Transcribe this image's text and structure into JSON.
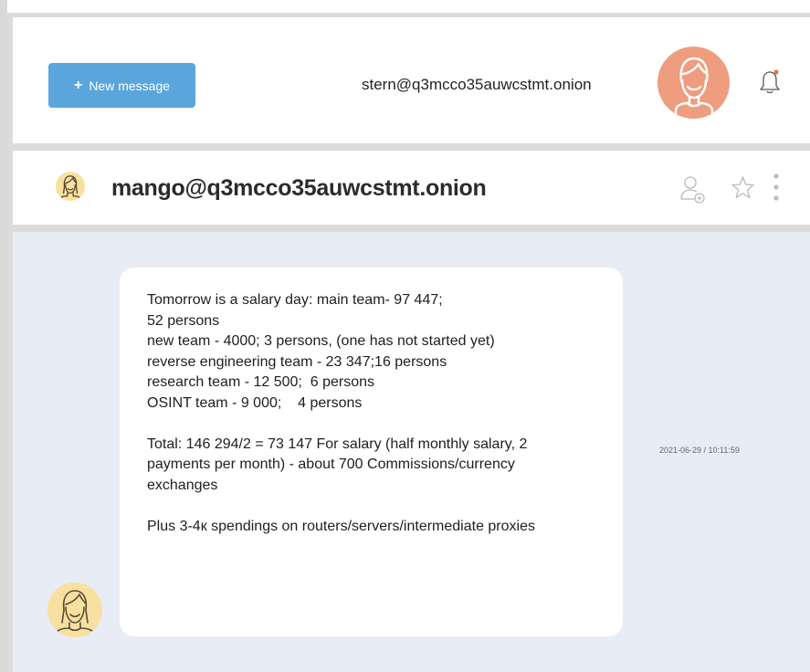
{
  "header": {
    "new_message_label": "New message",
    "new_message_icon": "+",
    "user_email": "stern@q3mcco35auwcstmt.onion"
  },
  "conversation": {
    "title": "mango@q3mcco35auwcstmt.onion"
  },
  "message": {
    "lines": [
      "Tomorrow is a salary day: main team- 97 447;",
      "52 persons",
      "new team - 4000; 3 persons, (one has not started yet)",
      "reverse engineering team - 23 347;16 persons",
      "research team - 12 500;  6 persons",
      "OSINT team - 9 000;    4 persons",
      "",
      "Total: 146 294/2 = 73 147 For salary (half monthly salary, 2",
      "payments per month) - about 700 Commissions/currency",
      "exchanges",
      "",
      "Plus 3-4к spendings on routers/servers/intermediate proxies"
    ],
    "timestamp": "2021-06-29 / 10:11:59"
  },
  "colors": {
    "accent": "#5aa5dc",
    "avatar_user": "#ee9d7f",
    "avatar_contact": "#f9e0a0",
    "chat_background": "#e7ecf5",
    "notification_dot": "#e8734a"
  },
  "icons": {
    "user_avatar": "user-avatar-icon",
    "bell": "bell-icon",
    "contact_avatar": "contact-avatar-icon",
    "add_contact": "add-contact-icon",
    "star": "star-icon",
    "more": "more-vertical-icon"
  }
}
